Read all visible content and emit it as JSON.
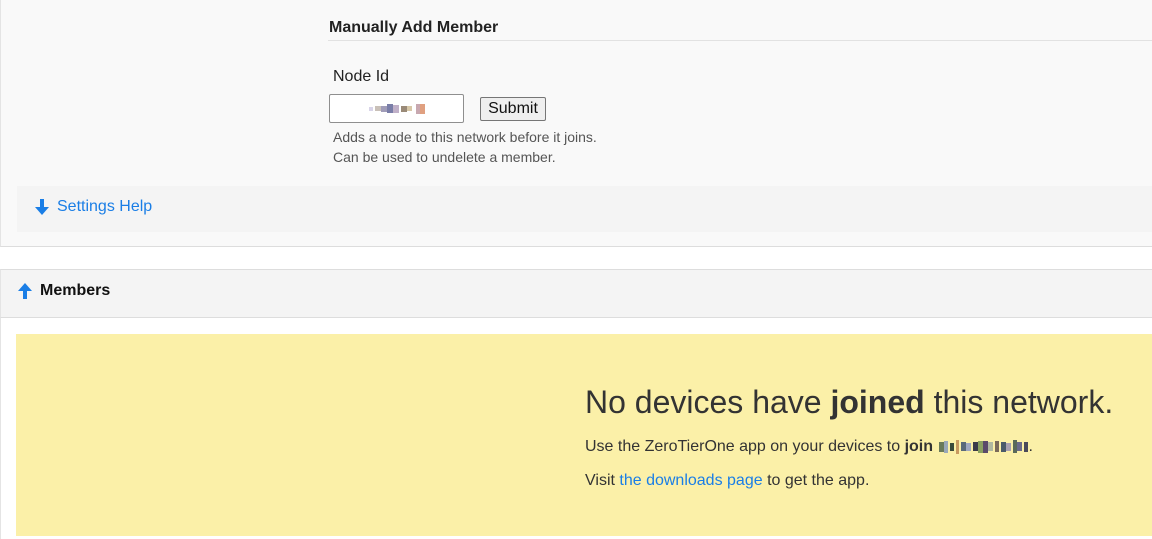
{
  "manual_add": {
    "title": "Manually Add Member",
    "node_label": "Node Id",
    "node_value_redacted": true,
    "submit_label": "Submit",
    "help_line_1": "Adds a node to this network before it joins.",
    "help_line_2": "Can be used to undelete a member."
  },
  "settings_help": {
    "label": "Settings Help",
    "icon": "arrow-down-icon"
  },
  "members": {
    "title": "Members",
    "icon": "arrow-up-icon",
    "empty_heading_pre": "No devices have",
    "empty_heading_bold": "joined",
    "empty_heading_post": "this network.",
    "join_line_pre": "Use the ZeroTierOne app on your devices to",
    "join_word": "join",
    "join_line_end": ".",
    "visit_pre": "Visit",
    "downloads_link": "the downloads page",
    "visit_post": "to get the app."
  },
  "colors": {
    "accent": "#1a7ee6",
    "notice_bg": "#fbf0a8"
  }
}
